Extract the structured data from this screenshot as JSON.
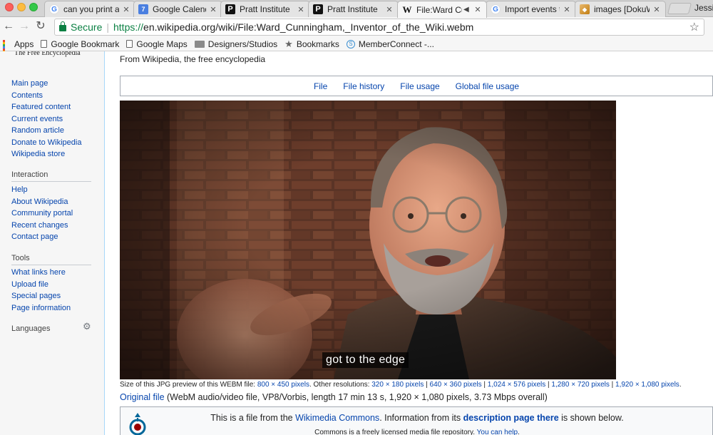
{
  "browser": {
    "tabs": [
      {
        "label": "can you print a",
        "icon": "google-icon"
      },
      {
        "label": "Google Calenda",
        "icon": "google-calendar-icon",
        "badge": "7"
      },
      {
        "label": "Pratt Institute",
        "icon": "pratt-icon",
        "glyph": "P"
      },
      {
        "label": "Pratt Institute",
        "icon": "pratt-icon",
        "glyph": "P"
      },
      {
        "label": "File:Ward Cu",
        "icon": "wikipedia-icon",
        "glyph": "W",
        "active": true
      },
      {
        "label": "Import events t",
        "icon": "google-icon"
      },
      {
        "label": "images [DokuW",
        "icon": "dokuwiki-icon"
      }
    ],
    "close_glyph": "✕",
    "profile_name": "Jessi",
    "address": {
      "secure_label": "Secure",
      "url_scheme": "https://",
      "url_rest": "en.wikipedia.org/wiki/File:Ward_Cunningham,_Inventor_of_the_Wiki.webm"
    },
    "bookmarks": [
      {
        "label": "Apps",
        "icon": "apps-grid-icon"
      },
      {
        "label": "Google Bookmark",
        "icon": "document-icon"
      },
      {
        "label": "Google Maps",
        "icon": "document-icon"
      },
      {
        "label": "Designers/Studios",
        "icon": "folder-icon"
      },
      {
        "label": "Bookmarks",
        "icon": "star-icon"
      },
      {
        "label": "MemberConnect -...",
        "icon": "memberconnect-icon"
      }
    ]
  },
  "sidebar": {
    "logo_tagline": "The Free Encyclopedia",
    "navigation": [
      "Main page",
      "Contents",
      "Featured content",
      "Current events",
      "Random article",
      "Donate to Wikipedia",
      "Wikipedia store"
    ],
    "interaction_heading": "Interaction",
    "interaction": [
      "Help",
      "About Wikipedia",
      "Community portal",
      "Recent changes",
      "Contact page"
    ],
    "tools_heading": "Tools",
    "tools": [
      "What links here",
      "Upload file",
      "Special pages",
      "Page information"
    ],
    "languages_heading": "Languages"
  },
  "content": {
    "tagline": "From Wikipedia, the free encyclopedia",
    "file_tabs": [
      "File",
      "File history",
      "File usage",
      "Global file usage"
    ],
    "video_caption": "got to the edge",
    "preview_prefix": "Size of this JPG preview of this WEBM file:",
    "preview_size": "800 × 450 pixels",
    "other_res_label": ". Other resolutions:",
    "resolutions": [
      "320 × 180 pixels",
      "640 × 360 pixels",
      "1,024 × 576 pixels",
      "1,280 × 720 pixels",
      "1,920 × 1,080 pixels"
    ],
    "res_separator": " | ",
    "res_end": ".",
    "original_link": "Original file",
    "original_details": "(WebM audio/video file, VP8/Vorbis, length 17 min 13 s, 1,920 × 1,080 pixels, 3.73 Mbps overall)",
    "commons_text_1": "This is a file from the ",
    "commons_link": "Wikimedia Commons",
    "commons_text_2": ". Information from its ",
    "commons_desc_link": "description page there",
    "commons_text_3": " is shown below.",
    "commons_sub_text": "Commons is a freely licensed media file repository. ",
    "commons_help_link": "You can help",
    "commons_sub_end": "."
  },
  "colors": {
    "link": "#0645ad",
    "secure_green": "#0b8043",
    "sidebar_bg": "#f6f6f6"
  }
}
